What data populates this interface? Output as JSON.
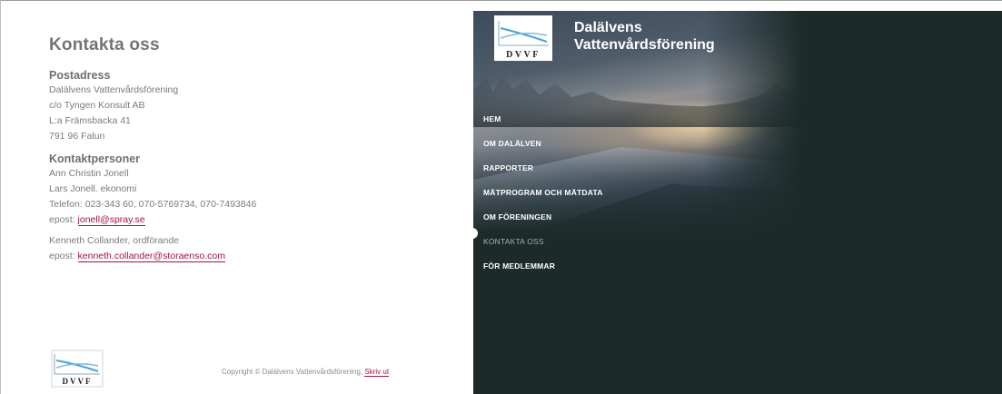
{
  "page": {
    "title": "Kontakta oss"
  },
  "postal": {
    "heading": "Postadress",
    "lines": [
      "Dalälvens Vattenvårdsförening",
      "c/o Tyngen Konsult AB",
      "L:a Främsbacka 41",
      "791 96 Falun"
    ]
  },
  "contacts": {
    "heading": "Kontaktpersoner",
    "person1": "Ann Christin Jonell",
    "person2": "Lars Jonell. ekonomi",
    "phone": "Telefon: 023-343 60, 070-5769734, 070-7493846",
    "email_label": "epost:",
    "email": "jonell@spray.se",
    "chair": "Kenneth Collander, ordförande",
    "chair_email_label": "epost:",
    "chair_email": "kenneth.collander@storaenso.com"
  },
  "footer": {
    "copyright": "Copyright © Dalälvens Vattenvårdsförening,",
    "print_link": "Skriv ut",
    "logo_text": "DVVF"
  },
  "header": {
    "logo_text": "DVVF",
    "site_name_line1": "Dalälvens",
    "site_name_line2": "Vattenvårdsförening"
  },
  "nav": {
    "items": [
      "HEM",
      "OM DALÄLVEN",
      "RAPPORTER",
      "MÄTPROGRAM OCH MÄTDATA",
      "OM FÖRENINGEN",
      "KONTAKTA OSS",
      "FÖR MEDLEMMAR"
    ],
    "active": "KONTAKTA OSS"
  },
  "colors": {
    "panel_bg": "#1c2a29",
    "link": "#a3143b",
    "text": "#7a7a7a"
  }
}
